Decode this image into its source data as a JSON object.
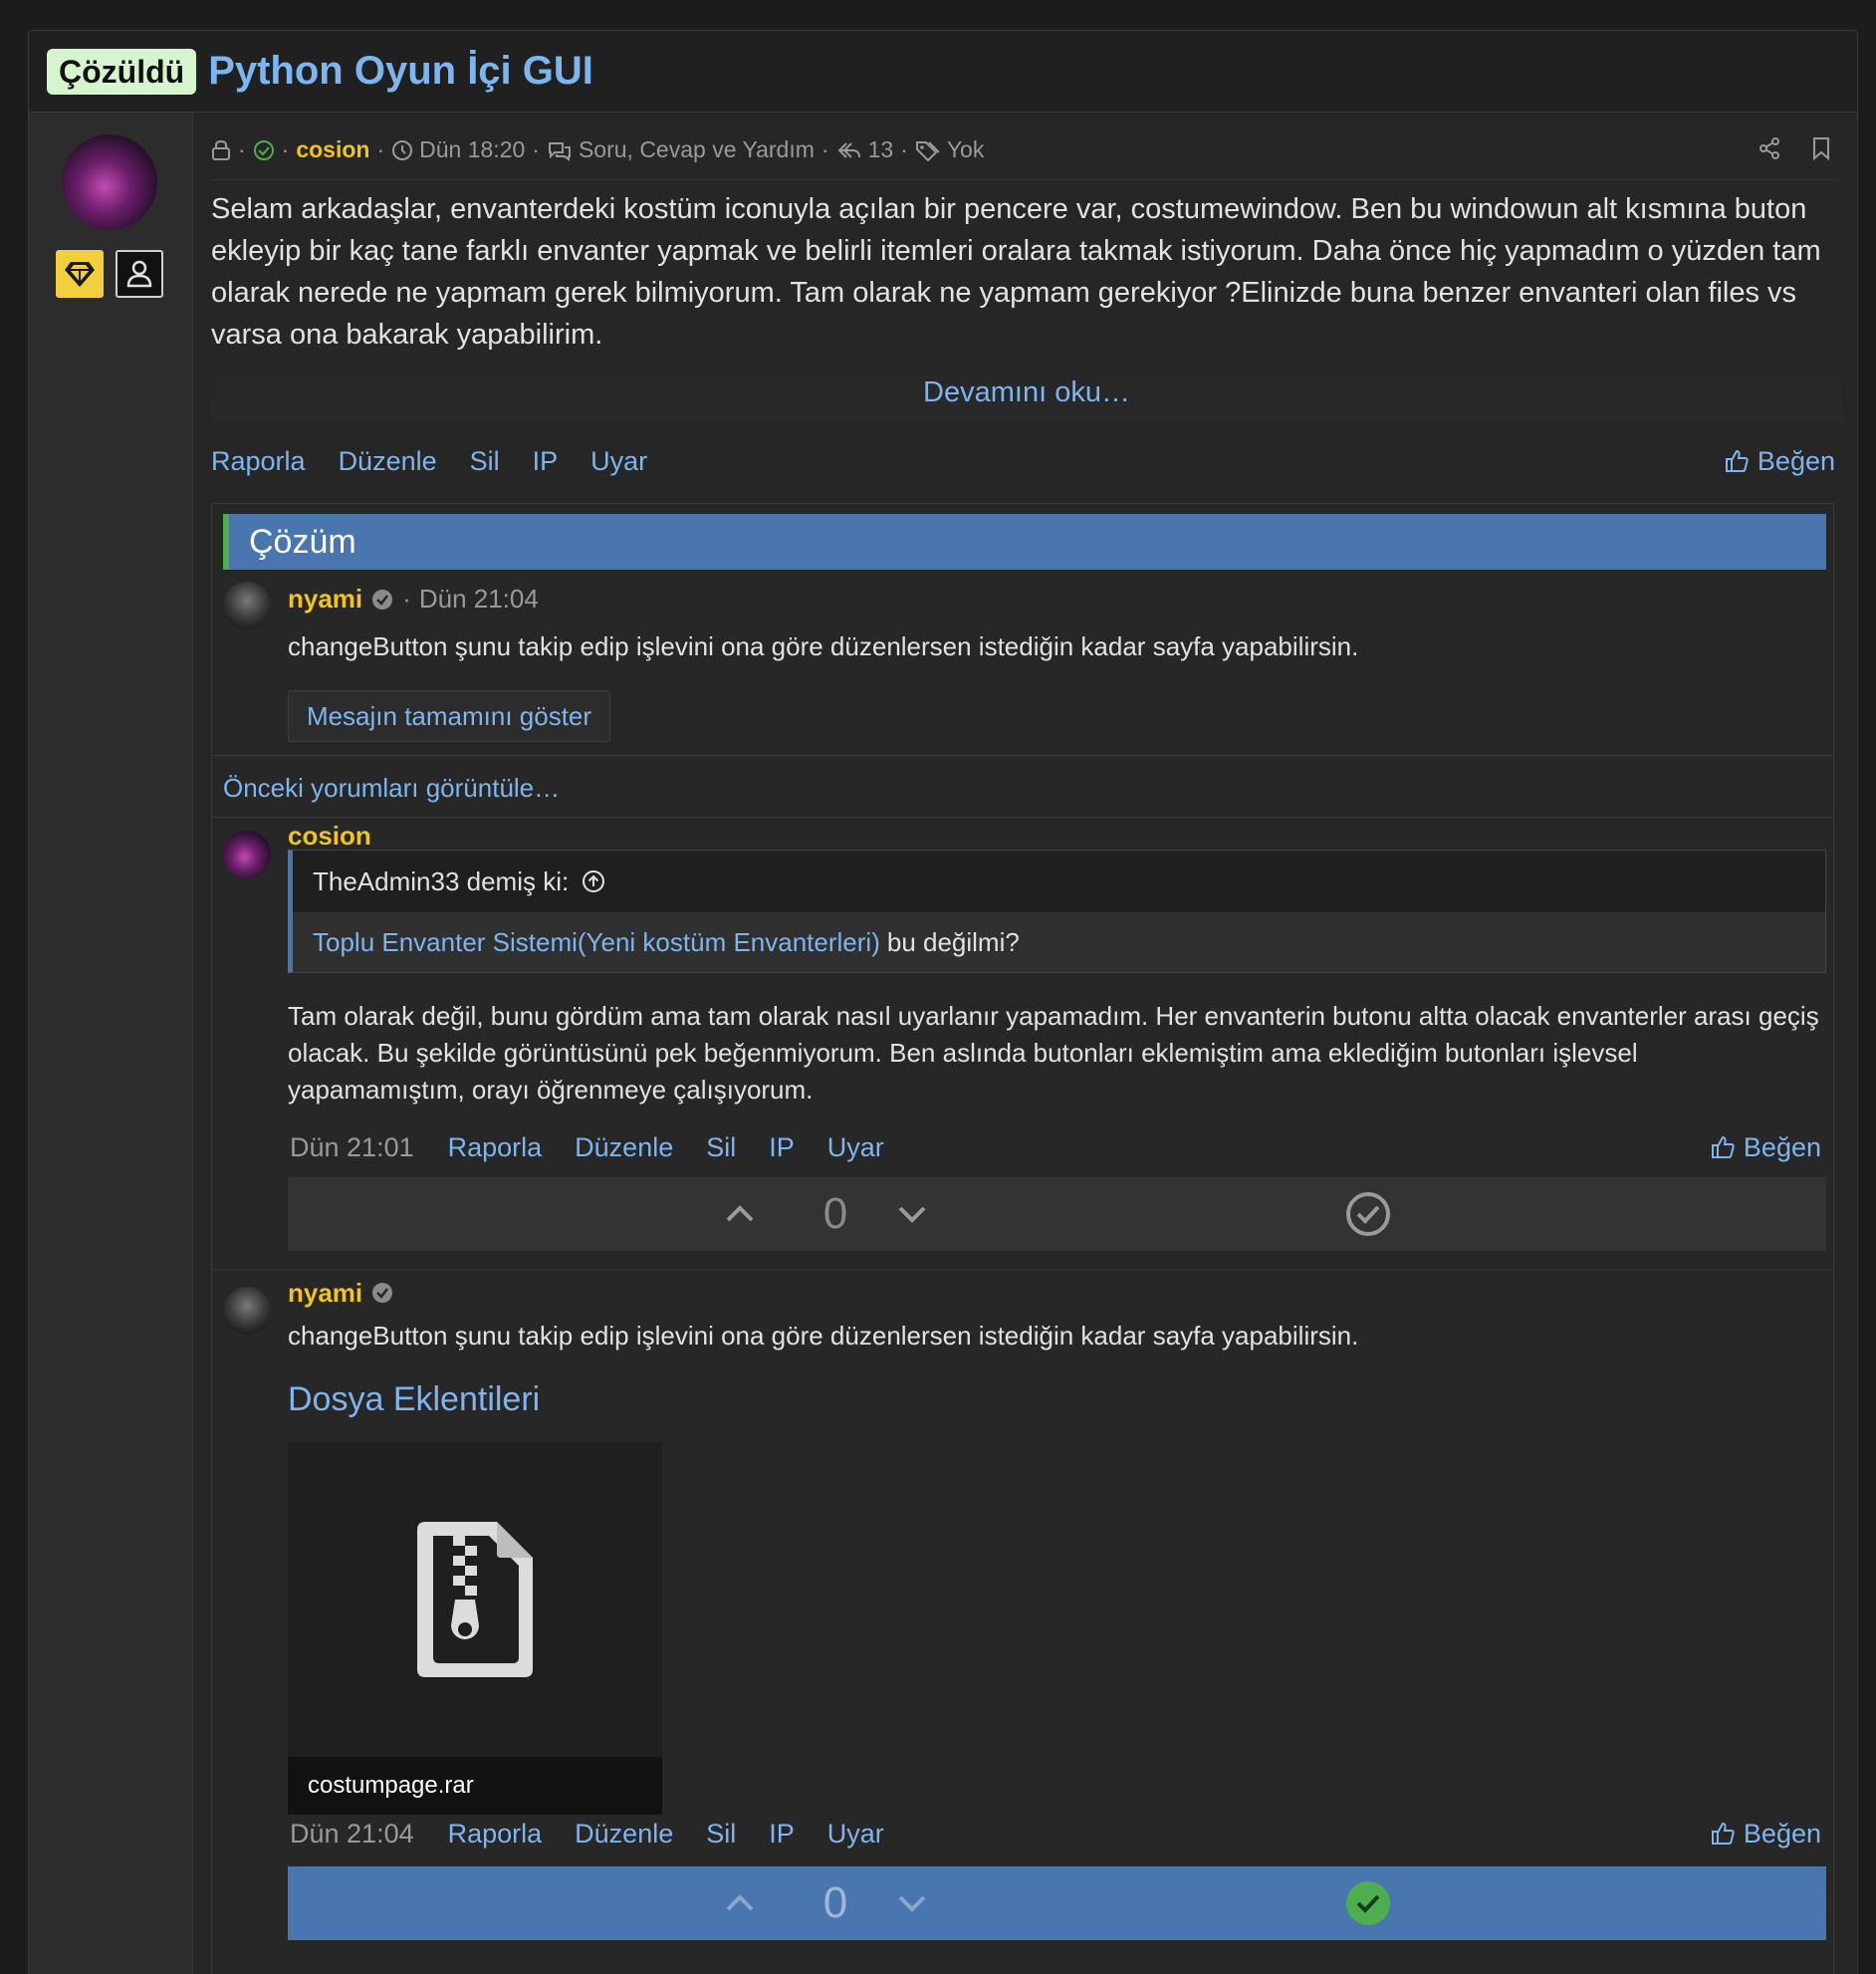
{
  "thread": {
    "solved_badge": "Çözüldü",
    "title": "Python Oyun İçi GUI"
  },
  "meta": {
    "author": "cosion",
    "time": "Dün 18:20",
    "forum": "Soru, Cevap ve Yardım",
    "replies": "13",
    "tags": "Yok"
  },
  "post": {
    "body": "Selam arkadaşlar, envanterdeki kostüm iconuyla açılan bir pencere var, costumewindow. Ben bu windowun alt kısmına buton ekleyip bir kaç tane farklı envanter yapmak ve belirli itemleri oralara takmak istiyorum. Daha önce hiç yapmadım o yüzden tam olarak nerede ne yapmam gerek bilmiyorum. Tam olarak ne yapmam gerekiyor ?Elinizde buna benzer envanteri olan files vs varsa ona bakarak yapabilirim.",
    "read_more": "Devamını oku…",
    "actions": [
      "Raporla",
      "Düzenle",
      "Sil",
      "IP",
      "Uyar"
    ],
    "like": "Beğen"
  },
  "solution": {
    "header": "Çözüm",
    "author": "nyami",
    "time_prefix": "·",
    "time": "Dün 21:04",
    "text": "changeButton şunu takip edip işlevini ona göre düzenlersen istediğin kadar sayfa yapabilirsin.",
    "show_full": "Mesajın tamamını göster"
  },
  "previous_comments": "Önceki yorumları görüntüle…",
  "comment1": {
    "author": "cosion",
    "quote_header": "TheAdmin33 demiş ki:",
    "quote_link": "Toplu Envanter Sistemi(Yeni kostüm Envanterleri)",
    "quote_rest": "bu değilmi?",
    "text": "Tam olarak değil, bunu gördüm ama tam olarak nasıl uyarlanır yapamadım. Her envanterin butonu altta olacak envanterler arası geçiş olacak. Bu şekilde görüntüsünü pek beğenmiyorum. Ben aslında butonları eklemiştim ama eklediğim butonları işlevsel yapamamıştım, orayı öğrenmeye çalışıyorum.",
    "time": "Dün 21:01",
    "actions": [
      "Raporla",
      "Düzenle",
      "Sil",
      "IP",
      "Uyar"
    ],
    "like": "Beğen",
    "votes": "0"
  },
  "comment2": {
    "author": "nyami",
    "text": "changeButton şunu takip edip işlevini ona göre düzenlersen istediğin kadar sayfa yapabilirsin.",
    "attachments_title": "Dosya Eklentileri",
    "attachment_name": "costumpage.rar",
    "time": "Dün 21:04",
    "actions": [
      "Raporla",
      "Düzenle",
      "Sil",
      "IP",
      "Uyar"
    ],
    "like": "Beğen",
    "votes": "0"
  },
  "colors": {
    "accent_blue": "#7fb5ee",
    "username_gold": "#f0c419",
    "solution_bar": "#4a76b0",
    "solved_green": "#4cae4f",
    "badge_bg": "#d6f5cf"
  },
  "icons": [
    "lock-icon",
    "check-circle-icon",
    "clock-icon",
    "comments-icon",
    "reply-icon",
    "tag-icon",
    "share-icon",
    "bookmark-icon",
    "thumbs-up-icon",
    "verified-icon",
    "arrow-up-circle-icon",
    "chevron-up-icon",
    "chevron-down-icon",
    "zip-file-icon",
    "gem-icon",
    "user-icon"
  ]
}
